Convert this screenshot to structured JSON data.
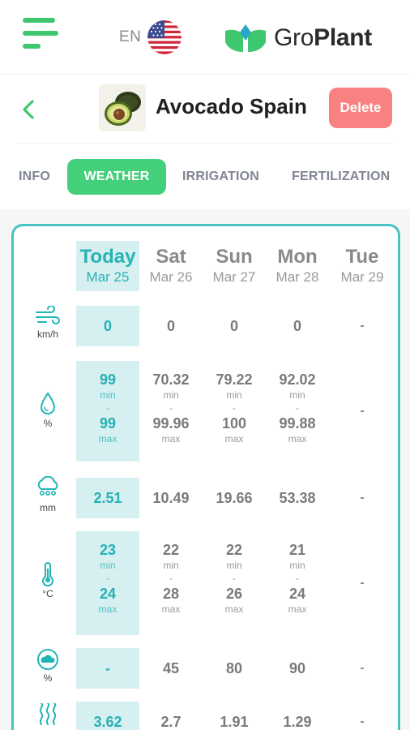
{
  "lang": {
    "code": "EN",
    "flag_icon": "us-flag-icon"
  },
  "logo": {
    "prefix": "Gro",
    "suffix": "Plant",
    "brand_color": "#3fc76f"
  },
  "plant": {
    "name": "Avocado Spain",
    "delete_label": "Delete"
  },
  "tabs": [
    {
      "label": "INFO",
      "active": false
    },
    {
      "label": "WEATHER",
      "active": true
    },
    {
      "label": "IRRIGATION",
      "active": false
    },
    {
      "label": "FERTILIZATION",
      "active": false
    }
  ],
  "colors": {
    "accent": "#44d07a",
    "teal": "#49c3c1",
    "delete": "#f98181",
    "today_col": "#d6eff0"
  },
  "days": [
    {
      "name": "Today",
      "date": "Mar 25"
    },
    {
      "name": "Sat",
      "date": "Mar 26"
    },
    {
      "name": "Sun",
      "date": "Mar 27"
    },
    {
      "name": "Mon",
      "date": "Mar 28"
    },
    {
      "name": "Tue",
      "date": "Mar 29"
    }
  ],
  "rows": {
    "wind": {
      "icon": "wind-icon",
      "unit": "km/h",
      "values": [
        "0",
        "0",
        "0",
        "0",
        "-"
      ]
    },
    "humidity": {
      "icon": "humidity-drop-icon",
      "unit": "%",
      "min_label": "min",
      "max_label": "max",
      "sep": "-",
      "min": [
        "99",
        "70.32",
        "79.22",
        "92.02"
      ],
      "max": [
        "99",
        "99.96",
        "100",
        "99.88"
      ],
      "tue": "-"
    },
    "rain": {
      "icon": "rain-cloud-icon",
      "unit": "mm",
      "values": [
        "2.51",
        "10.49",
        "19.66",
        "53.38",
        "-"
      ]
    },
    "temperature": {
      "icon": "thermometer-icon",
      "unit": "°C",
      "min_label": "min",
      "max_label": "max",
      "sep": "-",
      "min": [
        "23",
        "22",
        "22",
        "21"
      ],
      "max": [
        "24",
        "28",
        "26",
        "24"
      ],
      "tue": "-"
    },
    "cloud": {
      "icon": "cloud-cover-icon",
      "unit": "%",
      "values": [
        "-",
        "45",
        "80",
        "90",
        "-"
      ]
    },
    "evaporation": {
      "icon": "evaporation-icon",
      "values": [
        "3.62",
        "2.7",
        "1.91",
        "1.29",
        "-"
      ]
    }
  }
}
